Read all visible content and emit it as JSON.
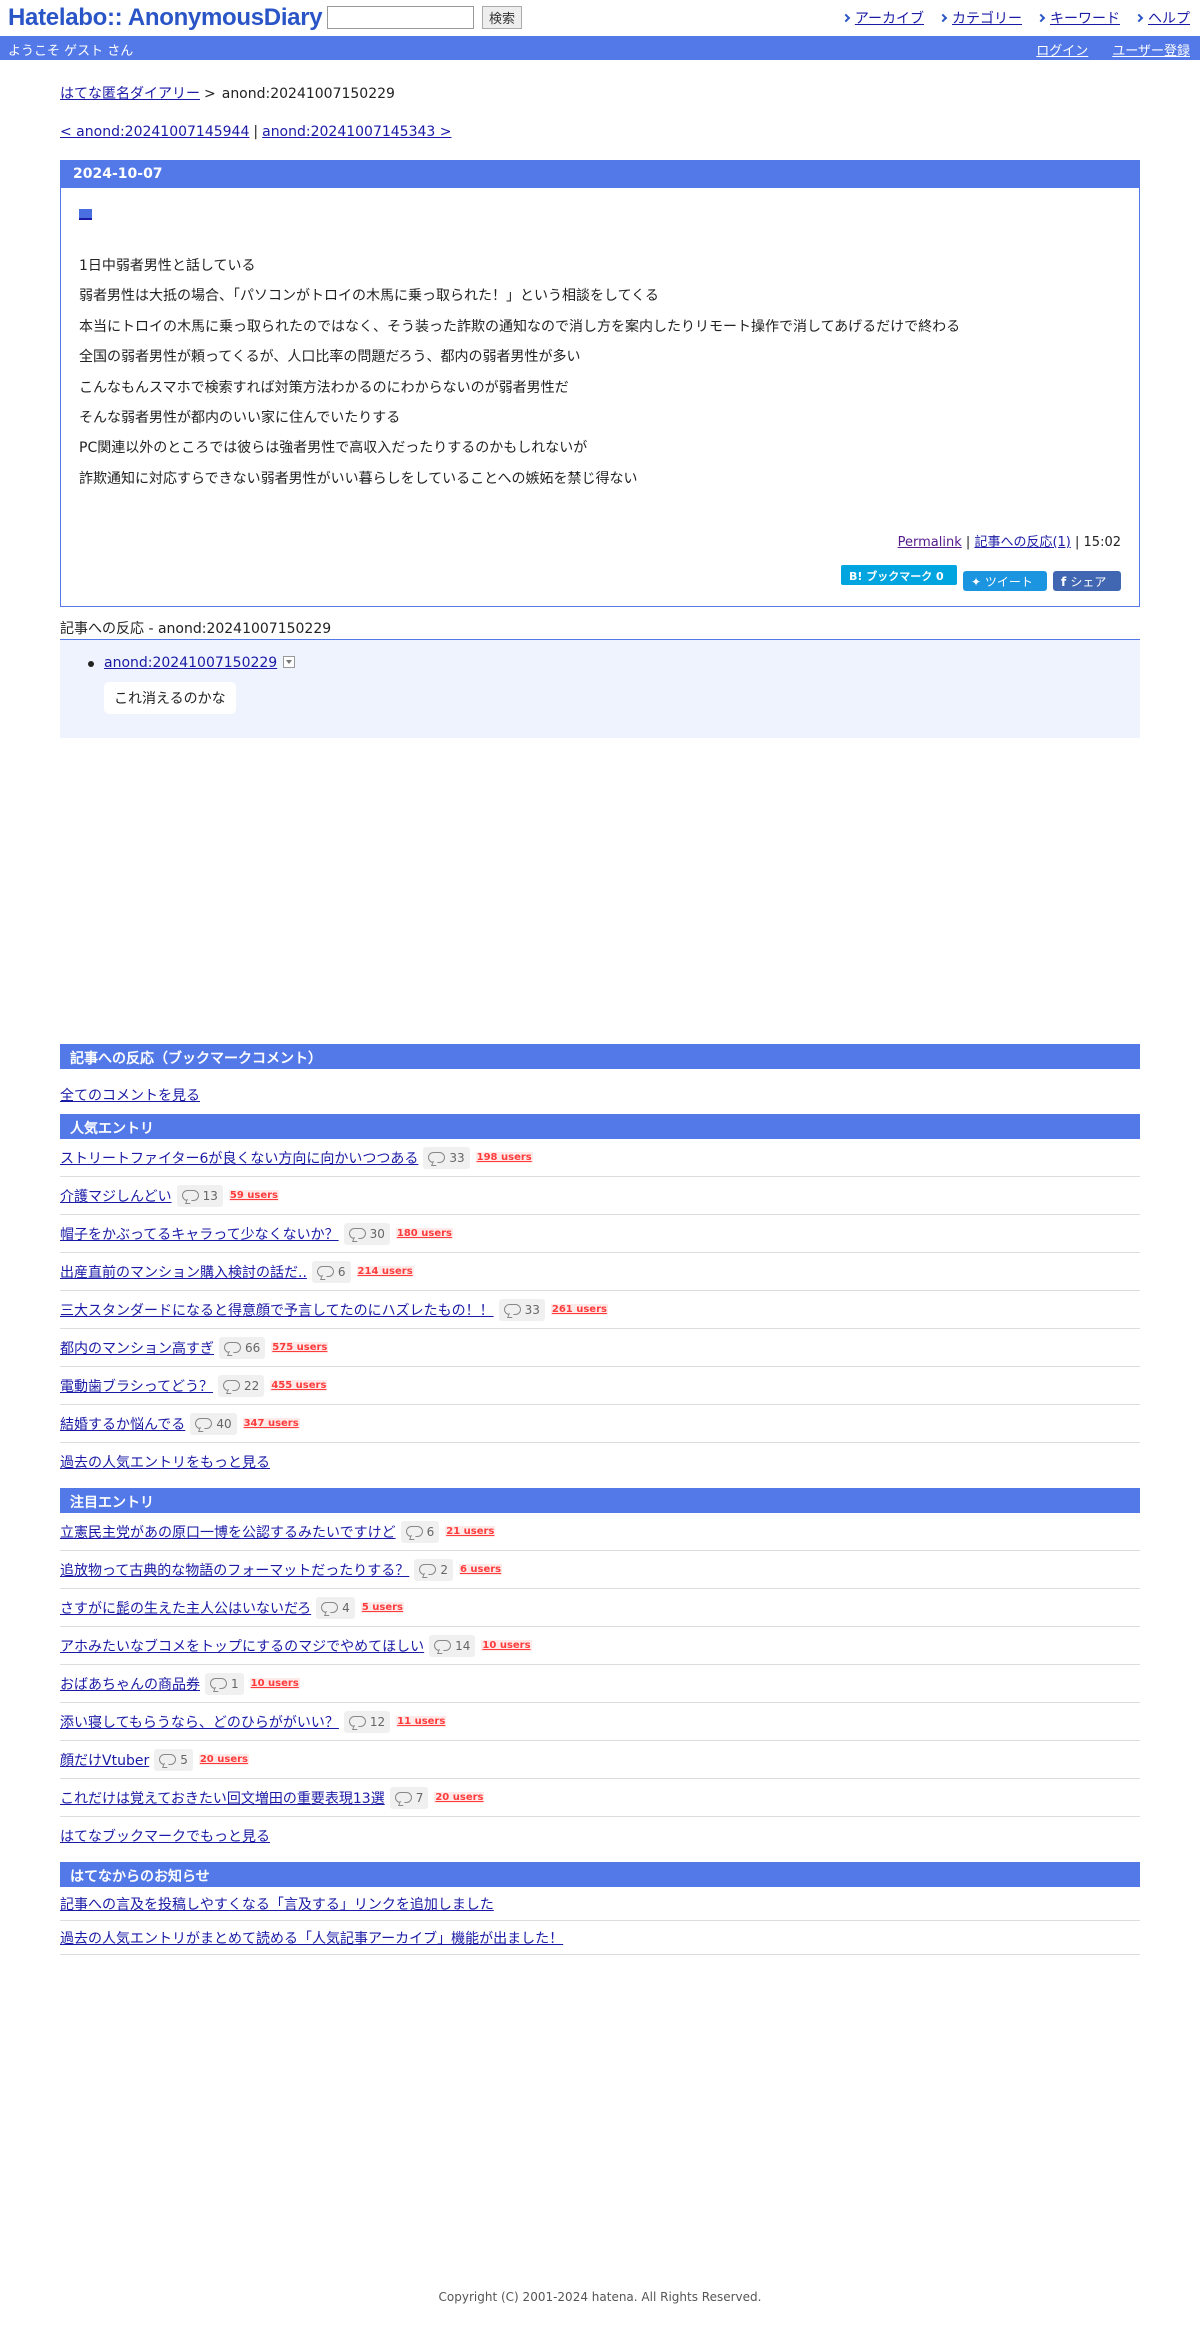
{
  "header": {
    "logo": "Hatelabo:: AnonymousDiary",
    "search_placeholder": "",
    "search_button": "検索",
    "nav": [
      "アーカイブ",
      "カテゴリー",
      "キーワード",
      "ヘルプ"
    ]
  },
  "welcome_bar": {
    "welcome": "ようこそ ゲスト さん",
    "login": "ログイン",
    "register": "ユーザー登録"
  },
  "breadcrumb": {
    "root": "はてな匿名ダイアリー",
    "separator": ">",
    "current": "anond:20241007150229"
  },
  "pager": {
    "prev": "< anond:20241007145944",
    "divider": "|",
    "next": "anond:20241007145343 >"
  },
  "entry": {
    "date": "2024-10-07",
    "lines": [
      "1日中弱者男性と話している",
      "弱者男性は大抵の場合、「パソコンがトロイの木馬に乗っ取られた！」という相談をしてくる",
      "本当にトロイの木馬に乗っ取られたのではなく、そう装った詐欺の通知なので消し方を案内したりリモート操作で消してあげるだけで終わる",
      "全国の弱者男性が頼ってくるが、人口比率の問題だろう、都内の弱者男性が多い",
      "こんなもんスマホで検索すれば対策方法わかるのにわからないのが弱者男性だ",
      "そんな弱者男性が都内のいい家に住んでいたりする",
      "PC関連以外のところでは彼らは強者男性で高収入だったりするのかもしれないが",
      "詐欺通知に対応すらできない弱者男性がいい暮らしをしていることへの嫉妬を禁じ得ない"
    ],
    "permalink": "Permalink",
    "pipe": "|",
    "reactions_link": "記事への反応(1)",
    "time": "15:02",
    "bookmark_btn": "B! ブックマーク  0",
    "tweet_btn": "ツイート",
    "share_btn": "シェア"
  },
  "reactions": {
    "title": "記事への反応 - anond:20241007150229",
    "items": [
      {
        "link": "anond:20241007150229",
        "text": "これ消えるのかな"
      }
    ]
  },
  "bookmark_comments": {
    "title": "記事への反応（ブックマークコメント）",
    "all_link": "全てのコメントを見る"
  },
  "popular": {
    "title": "人気エントリ",
    "items": [
      {
        "title": "ストリートファイター6が良くない方向に向かいつつある",
        "comments": "33",
        "users": "198 users"
      },
      {
        "title": "介護マジしんどい",
        "comments": "13",
        "users": "59 users"
      },
      {
        "title": "帽子をかぶってるキャラって少なくないか？",
        "comments": "30",
        "users": "180 users"
      },
      {
        "title": "出産直前のマンション購入検討の話だ..",
        "comments": "6",
        "users": "214 users"
      },
      {
        "title": "三大スタンダードになると得意顔で予言してたのにハズレたもの！！",
        "comments": "33",
        "users": "261 users"
      },
      {
        "title": "都内のマンション高すぎ",
        "comments": "66",
        "users": "575 users"
      },
      {
        "title": "電動歯ブラシってどう？",
        "comments": "22",
        "users": "455 users"
      },
      {
        "title": "結婚するか悩んでる",
        "comments": "40",
        "users": "347 users"
      }
    ],
    "more": "過去の人気エントリをもっと見る"
  },
  "attention": {
    "title": "注目エントリ",
    "items": [
      {
        "title": "立憲民主党があの原口一博を公認するみたいですけど",
        "comments": "6",
        "users": "21 users"
      },
      {
        "title": "追放物って古典的な物語のフォーマットだったりする？",
        "comments": "2",
        "users": "6 users"
      },
      {
        "title": "さすがに髭の生えた主人公はいないだろ",
        "comments": "4",
        "users": "5 users"
      },
      {
        "title": "アホみたいなブコメをトップにするのマジでやめてほしい",
        "comments": "14",
        "users": "10 users"
      },
      {
        "title": "おばあちゃんの商品券",
        "comments": "1",
        "users": "10 users"
      },
      {
        "title": "添い寝してもらうなら、どのひらががいい？",
        "comments": "12",
        "users": "11 users"
      },
      {
        "title": "顔だけVtuber",
        "comments": "5",
        "users": "20 users"
      },
      {
        "title": "これだけは覚えておきたい回文増田の重要表現13選",
        "comments": "7",
        "users": "20 users"
      }
    ],
    "more": "はてなブックマークでもっと見る"
  },
  "notices": {
    "title": "はてなからのお知らせ",
    "items": [
      "記事への言及を投稿しやすくなる「言及する」リンクを追加しました",
      "過去の人気エントリがまとめて読める「人気記事アーカイブ」機能が出ました！"
    ]
  },
  "footer": {
    "copyright": "Copyright (C) 2001-2024 hatena. All Rights Reserved."
  }
}
